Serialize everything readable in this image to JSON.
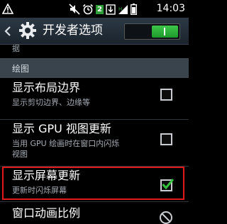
{
  "status_bar": {
    "time": "14:03",
    "sim_badge": "2",
    "icons": [
      "notification-icon",
      "mute-icon",
      "alarm-icon",
      "sim2-icon",
      "download-icon",
      "signal-icon",
      "battery-icon"
    ]
  },
  "action_bar": {
    "title": "开发者选项",
    "icon": "settings-gear-icon",
    "master_toggle_on": true
  },
  "content": {
    "cut_off_text": "据",
    "section_header": "绘图",
    "items": [
      {
        "title": "显示布局边界",
        "summary": "显示剪切边界、边缘等",
        "checked": false
      },
      {
        "title": "显示 GPU 视图更新",
        "summary_line1": "当用 GPU 绘画时在窗口内闪烁",
        "summary_line2": "视图",
        "checked": false
      },
      {
        "title": "显示屏幕更新",
        "summary": "更新时闪烁屏幕",
        "checked": true
      },
      {
        "title": "窗口动画比例"
      }
    ]
  },
  "colors": {
    "accent_green": "#2f9e3a",
    "highlight_red": "#e01a1a",
    "action_bar": "#2c3945"
  }
}
